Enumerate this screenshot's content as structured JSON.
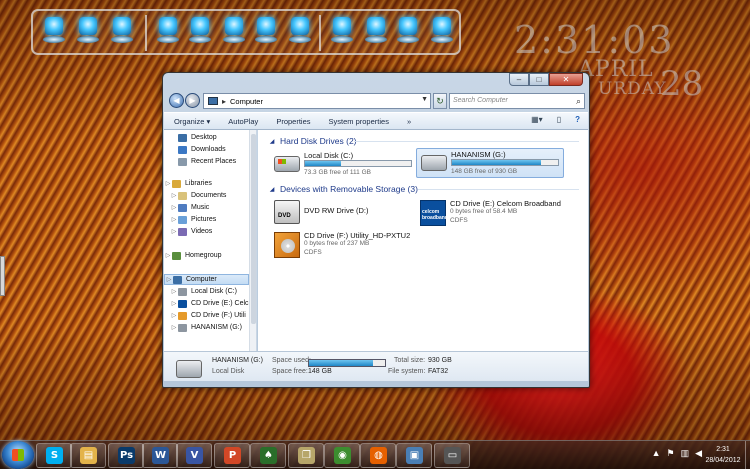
{
  "desktop": {
    "dock_icons": [
      "explorer-icon",
      "recycle-bin-icon",
      "ie-icon",
      "documents-icon",
      "folder-icon",
      "media-icon",
      "music-icon",
      "mail-icon",
      "feather-icon",
      "map-icon",
      "drive-icon",
      "network-icon"
    ],
    "clock": {
      "time": "2:31:03",
      "month": "APRIL",
      "dayname": "URDAY",
      "daynum": "28"
    }
  },
  "window": {
    "title_buttons": {
      "minimize": "–",
      "maximize": "□",
      "close": "✕"
    },
    "address": {
      "path": "Computer",
      "separator": "▸"
    },
    "search": {
      "placeholder": "Search Computer"
    },
    "toolbar": [
      "Organize ▾",
      "AutoPlay",
      "Properties",
      "System properties",
      "»"
    ],
    "nav": {
      "items": [
        {
          "label": "Desktop",
          "indent": 1
        },
        {
          "label": "Downloads",
          "indent": 1
        },
        {
          "label": "Recent Places",
          "indent": 1
        },
        {
          "label": "Libraries",
          "indent": 0
        },
        {
          "label": "Documents",
          "indent": 1
        },
        {
          "label": "Music",
          "indent": 1
        },
        {
          "label": "Pictures",
          "indent": 1
        },
        {
          "label": "Videos",
          "indent": 1
        },
        {
          "label": "Homegroup",
          "indent": 0
        },
        {
          "label": "Computer",
          "indent": 0
        },
        {
          "label": "Local Disk (C:)",
          "indent": 1
        },
        {
          "label": "CD Drive (E:) Celc",
          "indent": 1
        },
        {
          "label": "CD Drive (F:) Utili",
          "indent": 1
        },
        {
          "label": "HANANISM (G:)",
          "indent": 1
        }
      ]
    },
    "content": {
      "hdd_header": "Hard Disk Drives (2)",
      "removable_header": "Devices with Removable Storage (3)",
      "drives": [
        {
          "name": "Local Disk (C:)",
          "sub": "73.3 GB free of 111 GB",
          "used_fraction": 0.34
        },
        {
          "name": "HANANISM (G:)",
          "sub": "148 GB free of 930 GB",
          "used_fraction": 0.84
        }
      ],
      "removable": [
        {
          "name": "DVD RW Drive (D:)",
          "sub": "",
          "sub2": ""
        },
        {
          "name": "CD Drive (E:) Celcom Broadband",
          "sub": "0 bytes free of 58.4 MB",
          "sub2": "CDFS",
          "icon_text": "celcom broadband"
        },
        {
          "name": "CD Drive (F:) Utility_HD-PXTU2",
          "sub": "0 bytes free of 237 MB",
          "sub2": "CDFS"
        }
      ]
    },
    "details": {
      "name": "HANANISM (G:)",
      "type": "Local Disk",
      "space_used_label": "Space used:",
      "space_free_label": "Space free:",
      "space_free": "148 GB",
      "used_fraction": 0.84,
      "total_size_label": "Total size:",
      "total_size": "930 GB",
      "fs_label": "File system:",
      "fs": "FAT32"
    }
  },
  "taskbar": {
    "buttons": [
      {
        "name": "skype",
        "glyph": "S",
        "color": "#00aff0"
      },
      {
        "name": "explorer",
        "glyph": "▤",
        "color": "#e3b34a"
      },
      {
        "name": "photoshop",
        "glyph": "Ps",
        "color": "#0a3a6a"
      },
      {
        "name": "word",
        "glyph": "W",
        "color": "#2b5797"
      },
      {
        "name": "visio",
        "glyph": "V",
        "color": "#3955a3"
      },
      {
        "name": "powerpoint",
        "glyph": "P",
        "color": "#d24726"
      },
      {
        "name": "solitaire",
        "glyph": "♠",
        "color": "#2a6e2a"
      },
      {
        "name": "folder-pane",
        "glyph": "❒",
        "color": "#b7a66a"
      },
      {
        "name": "media-center",
        "glyph": "◉",
        "color": "#3c8d2f"
      },
      {
        "name": "firefox",
        "glyph": "◍",
        "color": "#e66000"
      },
      {
        "name": "network",
        "glyph": "▣",
        "color": "#4a7fb5"
      },
      {
        "name": "device",
        "glyph": "▭",
        "color": "#555"
      }
    ],
    "tray_icons": [
      "▲",
      "⚑",
      "▥",
      "◀"
    ],
    "clock_time": "2:31",
    "clock_date": "28/04/2012"
  }
}
